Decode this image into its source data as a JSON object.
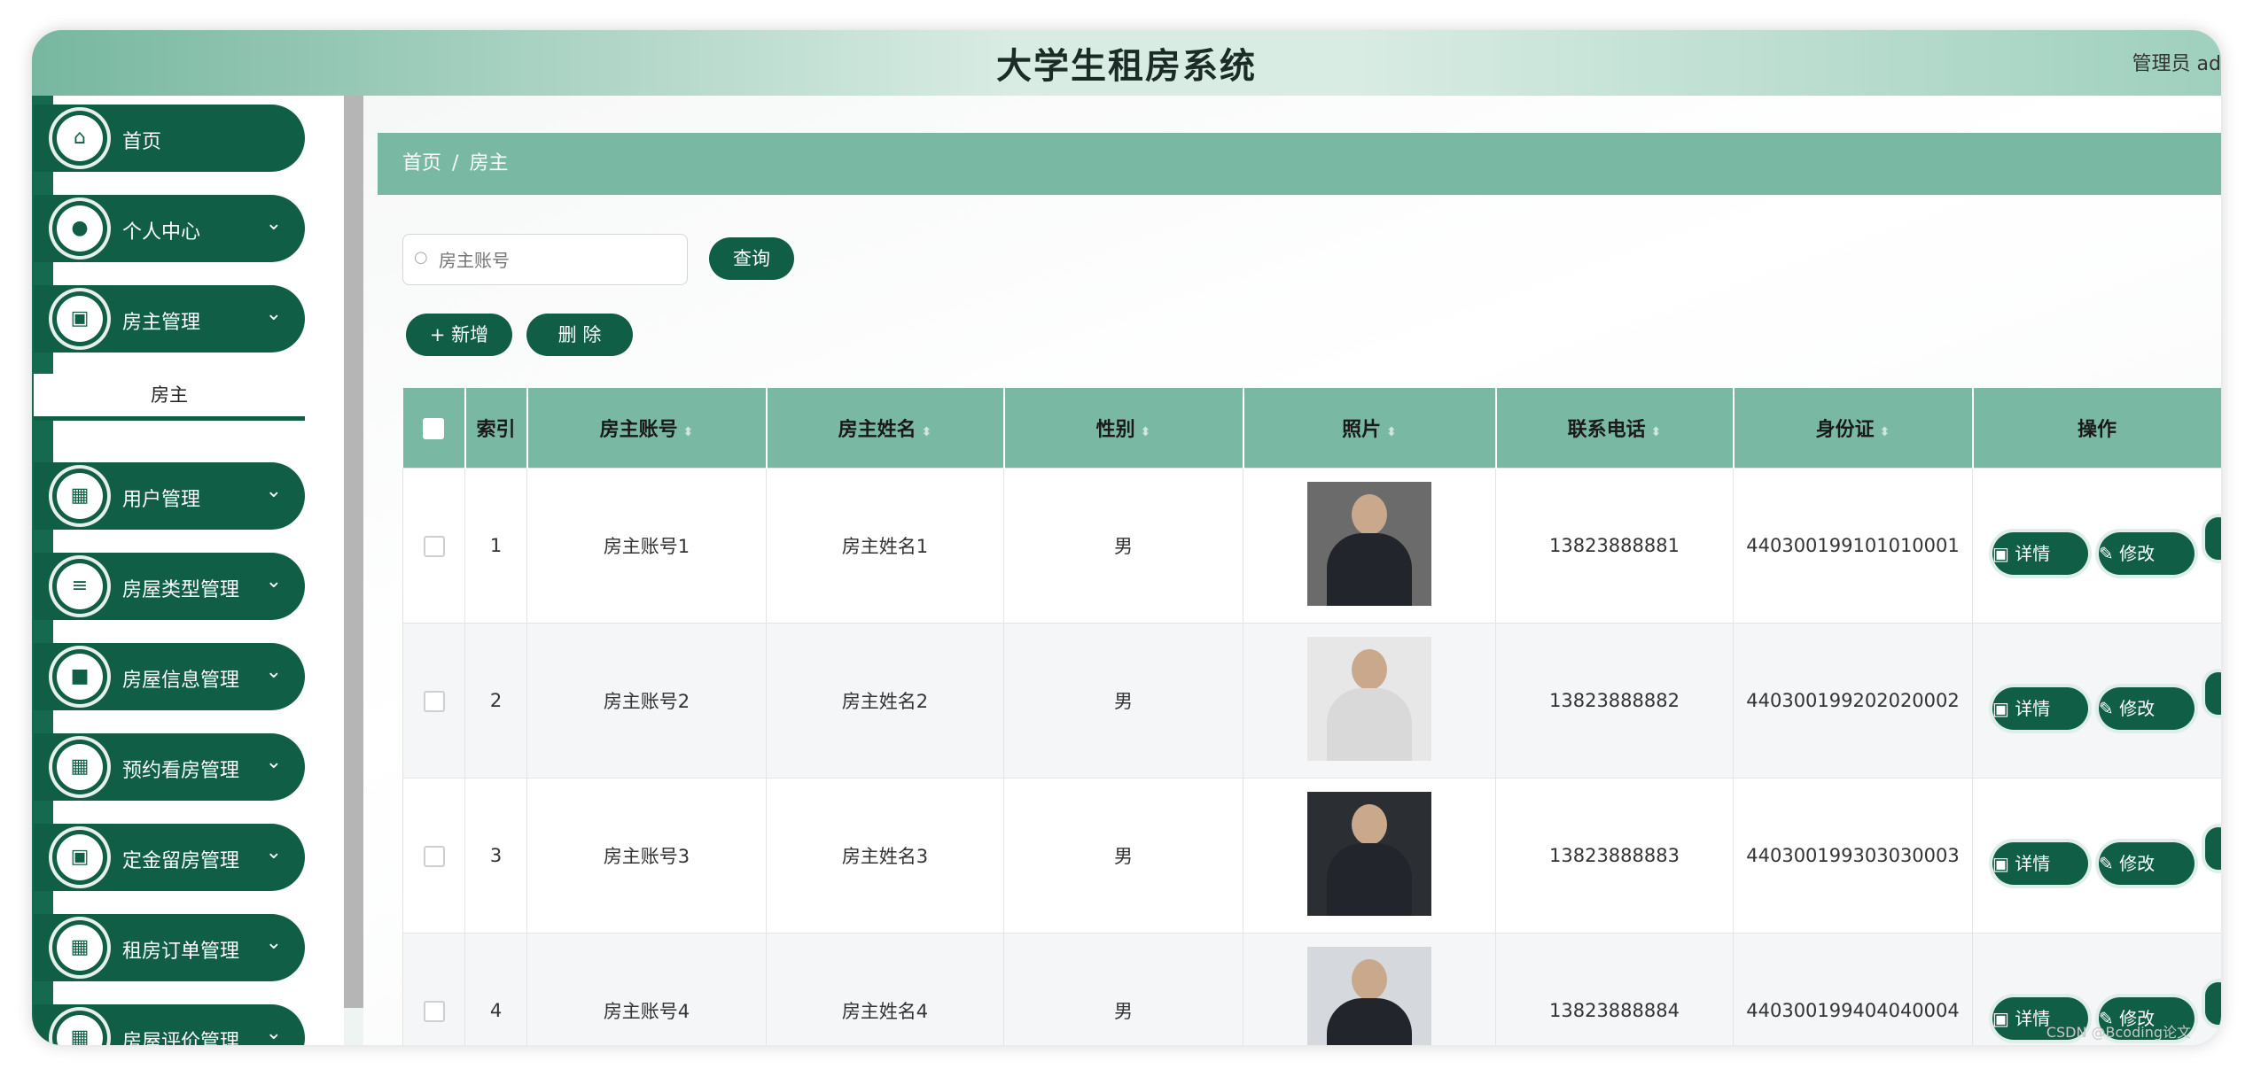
{
  "app": {
    "title": "大学生租房系统",
    "user_label": "管理员 ad"
  },
  "sidebar": {
    "items": [
      {
        "label": "首页",
        "icon": "home-icon",
        "glyph": "⌂",
        "has_chevron": false
      },
      {
        "label": "个人中心",
        "icon": "user-icon",
        "glyph": "●",
        "has_chevron": true
      },
      {
        "label": "房主管理",
        "icon": "clipboard-icon",
        "glyph": "▣",
        "has_chevron": true
      },
      {
        "label": "用户管理",
        "icon": "grid-icon",
        "glyph": "▦",
        "has_chevron": true
      },
      {
        "label": "房屋类型管理",
        "icon": "list-icon",
        "glyph": "≡",
        "has_chevron": true
      },
      {
        "label": "房屋信息管理",
        "icon": "briefcase-icon",
        "glyph": "■",
        "has_chevron": true
      },
      {
        "label": "预约看房管理",
        "icon": "grid-icon",
        "glyph": "▦",
        "has_chevron": true
      },
      {
        "label": "定金留房管理",
        "icon": "clipboard-icon",
        "glyph": "▣",
        "has_chevron": true
      },
      {
        "label": "租房订单管理",
        "icon": "grid-icon",
        "glyph": "▦",
        "has_chevron": true
      },
      {
        "label": "房屋评价管理",
        "icon": "grid-icon",
        "glyph": "▦",
        "has_chevron": true
      }
    ],
    "subitem": "房主"
  },
  "breadcrumb": {
    "home": "首页",
    "sep": "/",
    "current": "房主"
  },
  "search": {
    "placeholder": "房主账号",
    "value": "",
    "button": "查询"
  },
  "toolbar": {
    "add": "+ 新增",
    "delete": "删 除"
  },
  "table": {
    "columns": [
      "索引",
      "房主账号",
      "房主姓名",
      "性别",
      "照片",
      "联系电话",
      "身份证",
      "操作"
    ],
    "rows": [
      {
        "index": "1",
        "account": "房主账号1",
        "name": "房主姓名1",
        "gender": "男",
        "photo": "man-suit",
        "phone": "13823888881",
        "id_card": "440300199101010001"
      },
      {
        "index": "2",
        "account": "房主账号2",
        "name": "房主姓名2",
        "gender": "男",
        "photo": "woman-light",
        "phone": "13823888882",
        "id_card": "440300199202020002"
      },
      {
        "index": "3",
        "account": "房主账号3",
        "name": "房主姓名3",
        "gender": "男",
        "photo": "man-dark",
        "phone": "13823888883",
        "id_card": "440300199303030003"
      },
      {
        "index": "4",
        "account": "房主账号4",
        "name": "房主姓名4",
        "gender": "男",
        "photo": "woman-gray",
        "phone": "13823888884",
        "id_card": "440300199404040004"
      }
    ],
    "actions": {
      "detail": "▣ 详情",
      "edit": "✎ 修改"
    }
  },
  "watermark": "CSDN @Bcoding论文"
}
